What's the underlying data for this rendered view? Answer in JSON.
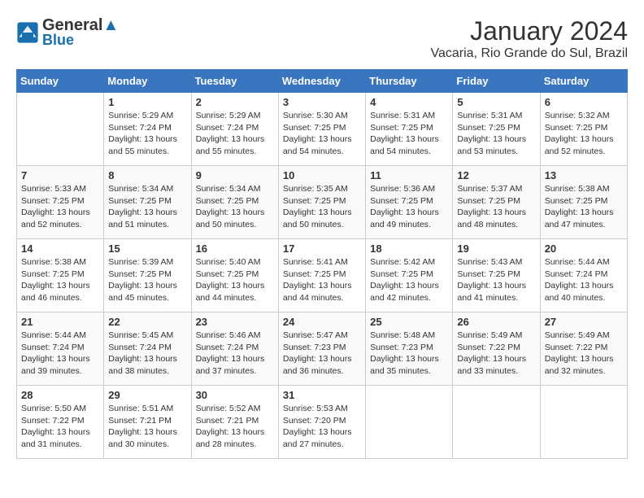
{
  "header": {
    "logo_line1": "General",
    "logo_line2": "Blue",
    "month": "January 2024",
    "location": "Vacaria, Rio Grande do Sul, Brazil"
  },
  "days_of_week": [
    "Sunday",
    "Monday",
    "Tuesday",
    "Wednesday",
    "Thursday",
    "Friday",
    "Saturday"
  ],
  "weeks": [
    [
      {
        "num": "",
        "info": ""
      },
      {
        "num": "1",
        "info": "Sunrise: 5:29 AM\nSunset: 7:24 PM\nDaylight: 13 hours\nand 55 minutes."
      },
      {
        "num": "2",
        "info": "Sunrise: 5:29 AM\nSunset: 7:24 PM\nDaylight: 13 hours\nand 55 minutes."
      },
      {
        "num": "3",
        "info": "Sunrise: 5:30 AM\nSunset: 7:25 PM\nDaylight: 13 hours\nand 54 minutes."
      },
      {
        "num": "4",
        "info": "Sunrise: 5:31 AM\nSunset: 7:25 PM\nDaylight: 13 hours\nand 54 minutes."
      },
      {
        "num": "5",
        "info": "Sunrise: 5:31 AM\nSunset: 7:25 PM\nDaylight: 13 hours\nand 53 minutes."
      },
      {
        "num": "6",
        "info": "Sunrise: 5:32 AM\nSunset: 7:25 PM\nDaylight: 13 hours\nand 52 minutes."
      }
    ],
    [
      {
        "num": "7",
        "info": "Sunrise: 5:33 AM\nSunset: 7:25 PM\nDaylight: 13 hours\nand 52 minutes."
      },
      {
        "num": "8",
        "info": "Sunrise: 5:34 AM\nSunset: 7:25 PM\nDaylight: 13 hours\nand 51 minutes."
      },
      {
        "num": "9",
        "info": "Sunrise: 5:34 AM\nSunset: 7:25 PM\nDaylight: 13 hours\nand 50 minutes."
      },
      {
        "num": "10",
        "info": "Sunrise: 5:35 AM\nSunset: 7:25 PM\nDaylight: 13 hours\nand 50 minutes."
      },
      {
        "num": "11",
        "info": "Sunrise: 5:36 AM\nSunset: 7:25 PM\nDaylight: 13 hours\nand 49 minutes."
      },
      {
        "num": "12",
        "info": "Sunrise: 5:37 AM\nSunset: 7:25 PM\nDaylight: 13 hours\nand 48 minutes."
      },
      {
        "num": "13",
        "info": "Sunrise: 5:38 AM\nSunset: 7:25 PM\nDaylight: 13 hours\nand 47 minutes."
      }
    ],
    [
      {
        "num": "14",
        "info": "Sunrise: 5:38 AM\nSunset: 7:25 PM\nDaylight: 13 hours\nand 46 minutes."
      },
      {
        "num": "15",
        "info": "Sunrise: 5:39 AM\nSunset: 7:25 PM\nDaylight: 13 hours\nand 45 minutes."
      },
      {
        "num": "16",
        "info": "Sunrise: 5:40 AM\nSunset: 7:25 PM\nDaylight: 13 hours\nand 44 minutes."
      },
      {
        "num": "17",
        "info": "Sunrise: 5:41 AM\nSunset: 7:25 PM\nDaylight: 13 hours\nand 44 minutes."
      },
      {
        "num": "18",
        "info": "Sunrise: 5:42 AM\nSunset: 7:25 PM\nDaylight: 13 hours\nand 42 minutes."
      },
      {
        "num": "19",
        "info": "Sunrise: 5:43 AM\nSunset: 7:25 PM\nDaylight: 13 hours\nand 41 minutes."
      },
      {
        "num": "20",
        "info": "Sunrise: 5:44 AM\nSunset: 7:24 PM\nDaylight: 13 hours\nand 40 minutes."
      }
    ],
    [
      {
        "num": "21",
        "info": "Sunrise: 5:44 AM\nSunset: 7:24 PM\nDaylight: 13 hours\nand 39 minutes."
      },
      {
        "num": "22",
        "info": "Sunrise: 5:45 AM\nSunset: 7:24 PM\nDaylight: 13 hours\nand 38 minutes."
      },
      {
        "num": "23",
        "info": "Sunrise: 5:46 AM\nSunset: 7:24 PM\nDaylight: 13 hours\nand 37 minutes."
      },
      {
        "num": "24",
        "info": "Sunrise: 5:47 AM\nSunset: 7:23 PM\nDaylight: 13 hours\nand 36 minutes."
      },
      {
        "num": "25",
        "info": "Sunrise: 5:48 AM\nSunset: 7:23 PM\nDaylight: 13 hours\nand 35 minutes."
      },
      {
        "num": "26",
        "info": "Sunrise: 5:49 AM\nSunset: 7:22 PM\nDaylight: 13 hours\nand 33 minutes."
      },
      {
        "num": "27",
        "info": "Sunrise: 5:49 AM\nSunset: 7:22 PM\nDaylight: 13 hours\nand 32 minutes."
      }
    ],
    [
      {
        "num": "28",
        "info": "Sunrise: 5:50 AM\nSunset: 7:22 PM\nDaylight: 13 hours\nand 31 minutes."
      },
      {
        "num": "29",
        "info": "Sunrise: 5:51 AM\nSunset: 7:21 PM\nDaylight: 13 hours\nand 30 minutes."
      },
      {
        "num": "30",
        "info": "Sunrise: 5:52 AM\nSunset: 7:21 PM\nDaylight: 13 hours\nand 28 minutes."
      },
      {
        "num": "31",
        "info": "Sunrise: 5:53 AM\nSunset: 7:20 PM\nDaylight: 13 hours\nand 27 minutes."
      },
      {
        "num": "",
        "info": ""
      },
      {
        "num": "",
        "info": ""
      },
      {
        "num": "",
        "info": ""
      }
    ]
  ]
}
